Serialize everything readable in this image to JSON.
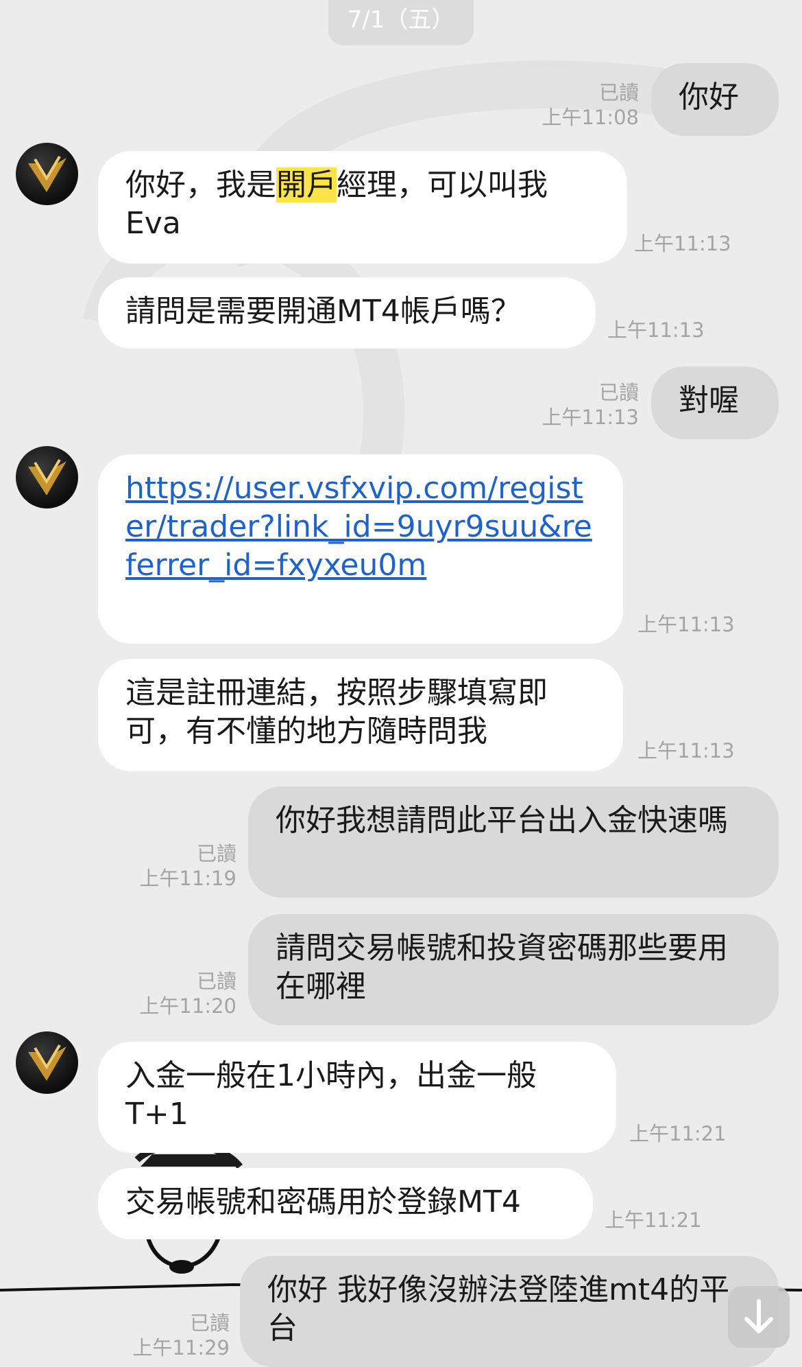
{
  "chat": {
    "date_label": "7/1（五）",
    "messages": [
      {
        "dir": "out",
        "text": "你好",
        "read": "已讀",
        "time": "上午11:08"
      },
      {
        "dir": "in",
        "text_pre": "你好，我是",
        "text_hl": "開戶",
        "text_post": "經理，可以叫我Eva",
        "time": "上午11:13"
      },
      {
        "dir": "in",
        "text": "請問是需要開通MT4帳戶嗎？",
        "time": "上午11:13"
      },
      {
        "dir": "out",
        "text": "對喔",
        "read": "已讀",
        "time": "上午11:13"
      },
      {
        "dir": "in",
        "link": "https://user.vsfxvip.com/register/trader?link_id=9uyr9suu&referrer_id=fxyxeu0m",
        "time": "上午11:13"
      },
      {
        "dir": "in",
        "text": "這是註冊連結，按照步驟填寫即可，有不懂的地方隨時問我",
        "time": "上午11:13"
      },
      {
        "dir": "out",
        "text": "你好我想請問此平台出入金快速嗎",
        "read": "已讀",
        "time": "上午11:19"
      },
      {
        "dir": "out",
        "text": "請問交易帳號和投資密碼那些要用在哪裡",
        "read": "已讀",
        "time": "上午11:20"
      },
      {
        "dir": "in",
        "text": "入金一般在1小時內，出金一般T+1",
        "time": "上午11:21"
      },
      {
        "dir": "in",
        "text": "交易帳號和密碼用於登錄MT4",
        "time": "上午11:21"
      },
      {
        "dir": "out",
        "text": "你好 我好像沒辦法登陸進mt4的平台",
        "read": "已讀",
        "time": "上午11:29"
      }
    ]
  },
  "icons": {
    "avatar": "gold-v-logo",
    "scroll_down": "arrow-down-icon"
  },
  "colors": {
    "background": "#ececec",
    "incoming": "#ffffff",
    "outgoing": "#d9d9d9",
    "link": "#1f62c9",
    "highlight": "#fbe44a"
  }
}
